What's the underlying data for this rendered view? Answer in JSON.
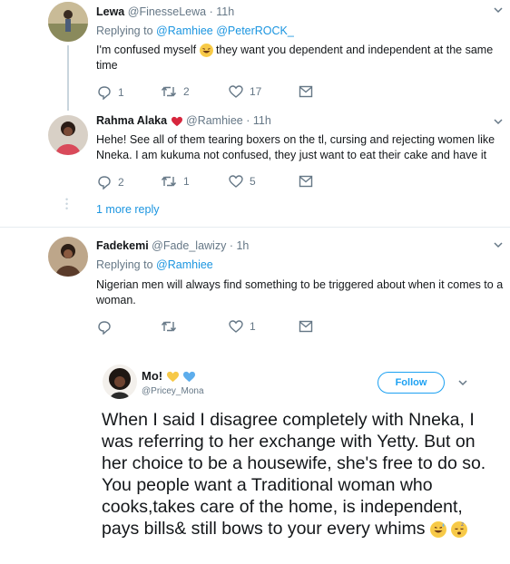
{
  "tweets": [
    {
      "name": "Lewa",
      "handle": "@FinesseLewa",
      "time": "· 11h",
      "replying_label": "Replying to",
      "replying_to": "@Ramhiee @PeterROCK_",
      "text_before_emoji": "I'm confused myself",
      "text_after_emoji": "they want you dependent and independent at the same time",
      "replies": "1",
      "retweets": "2",
      "likes": "17"
    },
    {
      "name": "Rahma Alaka",
      "handle": "@Ramhiee",
      "time": "· 11h",
      "text": "Hehe! See all of them tearing boxers on the tl, cursing and rejecting women like Nneka. I am kukuma not confused, they just want to eat their cake and have it",
      "replies": "2",
      "retweets": "1",
      "likes": "5"
    },
    {
      "name": "Fadekemi",
      "handle": "@Fade_lawizy",
      "time": "· 1h",
      "replying_label": "Replying to",
      "replying_to": "@Ramhiee",
      "text": "Nigerian men will always find something to be triggered about when it comes to a woman.",
      "replies": "",
      "retweets": "",
      "likes": "1"
    }
  ],
  "more_reply": "1 more reply",
  "embed": {
    "name": "Mo!",
    "handle": "@Pricey_Mona",
    "follow_label": "Follow",
    "text": "When I said I disagree completely with Nneka, I was referring to her exchange with Yetty. But on her choice to be a housewife, she's free to do so. You people want a Traditional woman who cooks,takes care of the home, is independent, pays bills& still bows to your every whims"
  },
  "colors": {
    "link": "#1b95e0",
    "muted": "#657786",
    "follow": "#1da1f2"
  }
}
